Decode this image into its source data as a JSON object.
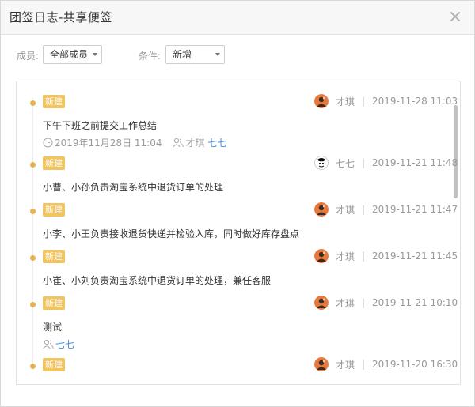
{
  "dialog": {
    "title": "团签日志-共享便签"
  },
  "filters": {
    "member_label": "成员:",
    "member_value": "全部成员",
    "condition_label": "条件:",
    "condition_value": "新增"
  },
  "entries": [
    {
      "badge": "新建",
      "author": "才琪",
      "avatar": "avatar-orange",
      "datetime": "2019-11-28 11:03",
      "content": "下午下班之前提交工作总结",
      "remind_time": "2019年11月28日 11:04",
      "participants_label": "才琪",
      "mention": "七七"
    },
    {
      "badge": "新建",
      "author": "七七",
      "avatar": "avatar-bw",
      "datetime": "2019-11-21 11:48",
      "content": "小曹、小孙负责淘宝系统中退货订单的处理"
    },
    {
      "badge": "新建",
      "author": "才琪",
      "avatar": "avatar-orange",
      "datetime": "2019-11-21 11:47",
      "content": "小李、小王负责接收退货快递并检验入库，同时做好库存盘点"
    },
    {
      "badge": "新建",
      "author": "才琪",
      "avatar": "avatar-orange",
      "datetime": "2019-11-21 11:45",
      "content": "小崔、小刘负责淘宝系统中退货订单的处理，兼任客服"
    },
    {
      "badge": "新建",
      "author": "才琪",
      "avatar": "avatar-orange",
      "datetime": "2019-11-21 10:10",
      "content": "测试",
      "mention": "七七"
    },
    {
      "badge": "新建",
      "author": "才琪",
      "avatar": "avatar-orange",
      "datetime": "2019-11-20 16:30"
    }
  ],
  "colors": {
    "badge_bg": "#f1c462",
    "dot": "#e4b454",
    "mention": "#4a8ee0"
  }
}
